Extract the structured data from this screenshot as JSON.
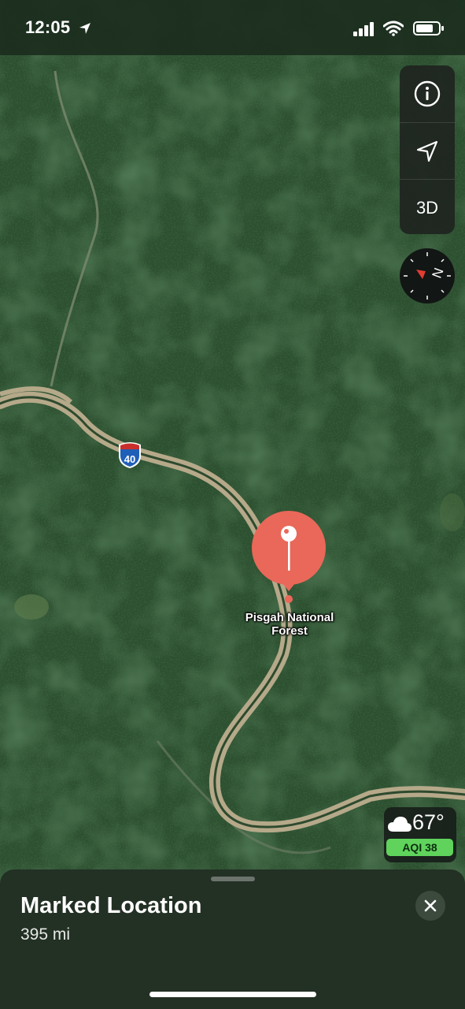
{
  "status_bar": {
    "time": "12:05",
    "icons": [
      "location-arrow-icon",
      "signal-icon",
      "wifi-icon",
      "battery-icon"
    ]
  },
  "map": {
    "style": "satellite",
    "highway_shield": "40",
    "place_label": "Pisgah National Forest",
    "pin_color": "#e9685a"
  },
  "controls": {
    "info_icon": "info-icon",
    "location_icon": "location-arrow-icon",
    "three_d_label": "3D",
    "compass_icon": "compass-icon"
  },
  "weather": {
    "icon": "cloud-icon",
    "temperature": "67°",
    "aqi_label": "AQI 38",
    "aqi_color": "#5fd35b"
  },
  "sheet": {
    "title": "Marked Location",
    "distance": "395 mi",
    "close_icon": "close-icon"
  }
}
